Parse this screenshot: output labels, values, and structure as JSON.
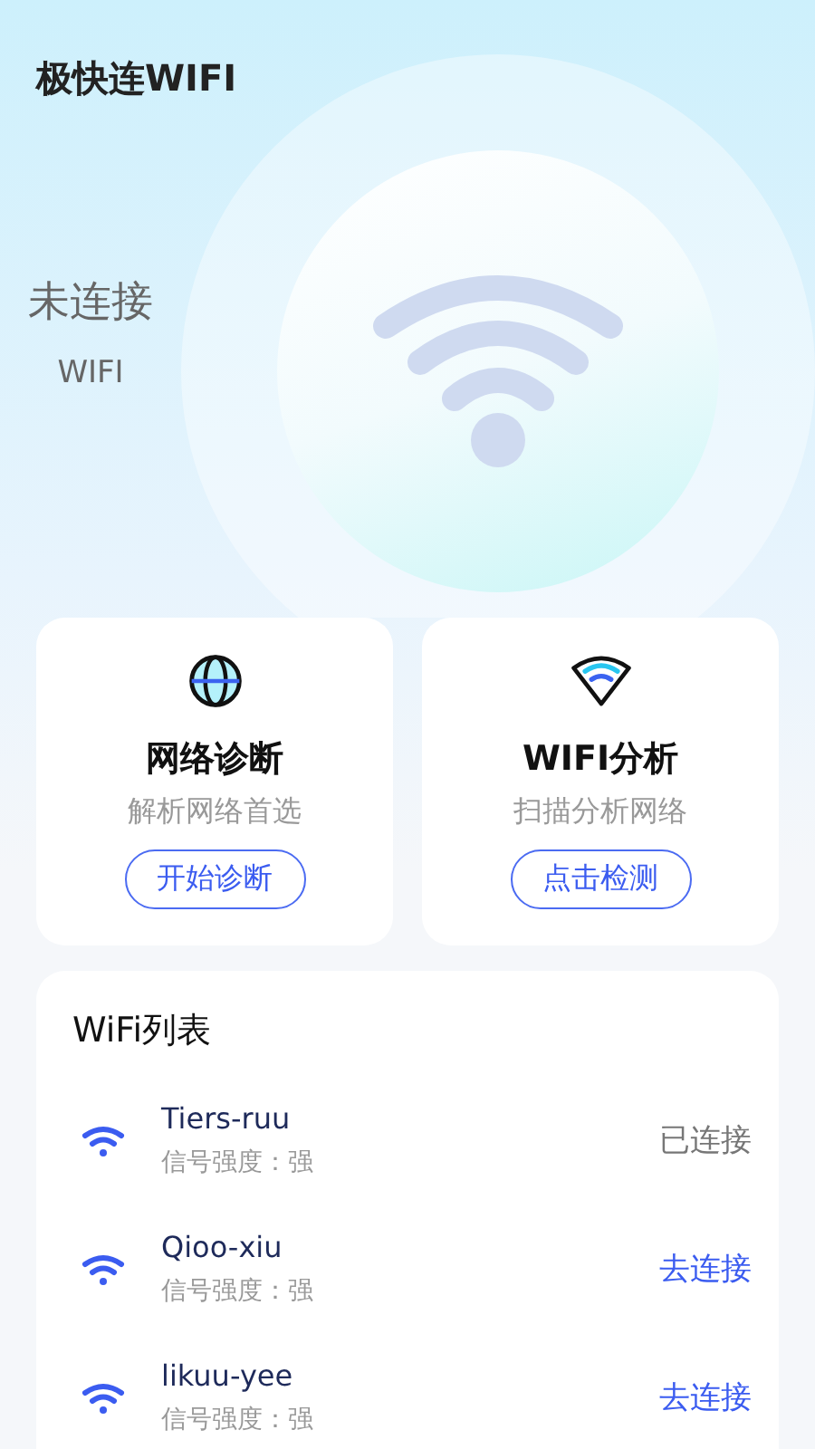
{
  "app_title": "极快连WIFI",
  "status": {
    "label": "未连接",
    "sub": "WIFI"
  },
  "tools": [
    {
      "kind": "globe",
      "title": "网络诊断",
      "subtitle": "解析网络首选",
      "button": "开始诊断"
    },
    {
      "kind": "wifi",
      "title": "WIFI分析",
      "subtitle": "扫描分析网络",
      "button": "点击检测"
    }
  ],
  "wifi_list": {
    "title": "WiFi列表",
    "networks": [
      {
        "name": "Tiers-ruu",
        "signal": "信号强度：强",
        "action": "已连接",
        "connected": true
      },
      {
        "name": "Qioo-xiu",
        "signal": "信号强度：强",
        "action": "去连接",
        "connected": false
      },
      {
        "name": "likuu-yee",
        "signal": "信号强度：强",
        "action": "去连接",
        "connected": false
      }
    ]
  }
}
